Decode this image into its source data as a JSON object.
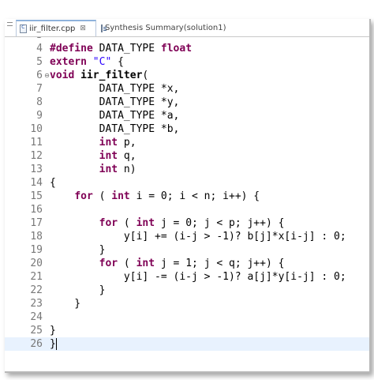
{
  "tabs": [
    {
      "label": "iir_filter.cpp",
      "active": true,
      "close": "⊠"
    },
    {
      "label": "Synthesis Summary(solution1)",
      "active": false
    }
  ],
  "colors": {
    "keyword": "#7f0055",
    "string": "#2a00ff",
    "text": "#000000",
    "line_number": "#787878",
    "current_line": "#e8f2fe",
    "tab_border": "#8fb2db"
  },
  "editor": {
    "top_partial_line": "3",
    "current_line_number": "26",
    "lines": [
      {
        "num": "4",
        "fold": "",
        "code": "#define DATA_TYPE float",
        "tokens": [
          {
            "t": "#define",
            "k": "kw"
          },
          {
            "t": " DATA_TYPE ",
            "k": ""
          },
          {
            "t": "float",
            "k": "kw"
          }
        ]
      },
      {
        "num": "5",
        "fold": "",
        "code": "extern \"C\" {",
        "tokens": [
          {
            "t": "extern",
            "k": "kw"
          },
          {
            "t": " ",
            "k": ""
          },
          {
            "t": "\"C\"",
            "k": "str"
          },
          {
            "t": " {",
            "k": ""
          }
        ]
      },
      {
        "num": "6",
        "fold": "⊖",
        "code": "void iir_filter(",
        "tokens": [
          {
            "t": "void",
            "k": "kw"
          },
          {
            "t": " ",
            "k": ""
          },
          {
            "t": "iir_filter",
            "k": "bold"
          },
          {
            "t": "(",
            "k": ""
          }
        ]
      },
      {
        "num": "7",
        "fold": "",
        "code": "        DATA_TYPE *x,",
        "tokens": [
          {
            "t": "        DATA_TYPE *x,",
            "k": ""
          }
        ]
      },
      {
        "num": "8",
        "fold": "",
        "code": "        DATA_TYPE *y,",
        "tokens": [
          {
            "t": "        DATA_TYPE *y,",
            "k": ""
          }
        ]
      },
      {
        "num": "9",
        "fold": "",
        "code": "        DATA_TYPE *a,",
        "tokens": [
          {
            "t": "        DATA_TYPE *a,",
            "k": ""
          }
        ]
      },
      {
        "num": "10",
        "fold": "",
        "code": "        DATA_TYPE *b,",
        "tokens": [
          {
            "t": "        DATA_TYPE *b,",
            "k": ""
          }
        ]
      },
      {
        "num": "11",
        "fold": "",
        "code": "        int p,",
        "tokens": [
          {
            "t": "        ",
            "k": ""
          },
          {
            "t": "int",
            "k": "kw"
          },
          {
            "t": " p,",
            "k": ""
          }
        ]
      },
      {
        "num": "12",
        "fold": "",
        "code": "        int q,",
        "tokens": [
          {
            "t": "        ",
            "k": ""
          },
          {
            "t": "int",
            "k": "kw"
          },
          {
            "t": " q,",
            "k": ""
          }
        ]
      },
      {
        "num": "13",
        "fold": "",
        "code": "        int n)",
        "tokens": [
          {
            "t": "        ",
            "k": ""
          },
          {
            "t": "int",
            "k": "kw"
          },
          {
            "t": " n)",
            "k": ""
          }
        ]
      },
      {
        "num": "14",
        "fold": "",
        "code": "{",
        "tokens": [
          {
            "t": "{",
            "k": ""
          }
        ]
      },
      {
        "num": "15",
        "fold": "",
        "code": "    for ( int i = 0; i < n; i++) {",
        "tokens": [
          {
            "t": "    ",
            "k": ""
          },
          {
            "t": "for",
            "k": "kw"
          },
          {
            "t": " ( ",
            "k": ""
          },
          {
            "t": "int",
            "k": "kw"
          },
          {
            "t": " i = 0; i < n; i++) {",
            "k": ""
          }
        ]
      },
      {
        "num": "16",
        "fold": "",
        "code": "",
        "tokens": []
      },
      {
        "num": "17",
        "fold": "",
        "code": "        for ( int j = 0; j < p; j++) {",
        "tokens": [
          {
            "t": "        ",
            "k": ""
          },
          {
            "t": "for",
            "k": "kw"
          },
          {
            "t": " ( ",
            "k": ""
          },
          {
            "t": "int",
            "k": "kw"
          },
          {
            "t": " j = 0; j < p; j++) {",
            "k": ""
          }
        ]
      },
      {
        "num": "18",
        "fold": "",
        "code": "            y[i] += (i-j > -1)? b[j]*x[i-j] : 0;",
        "tokens": [
          {
            "t": "            y[i] += (i-j > -1)? b[j]*x[i-j] : 0;",
            "k": ""
          }
        ]
      },
      {
        "num": "19",
        "fold": "",
        "code": "        }",
        "tokens": [
          {
            "t": "        }",
            "k": ""
          }
        ]
      },
      {
        "num": "20",
        "fold": "",
        "code": "        for ( int j = 1; j < q; j++) {",
        "tokens": [
          {
            "t": "        ",
            "k": ""
          },
          {
            "t": "for",
            "k": "kw"
          },
          {
            "t": " ( ",
            "k": ""
          },
          {
            "t": "int",
            "k": "kw"
          },
          {
            "t": " j = 1; j < q; j++) {",
            "k": ""
          }
        ]
      },
      {
        "num": "21",
        "fold": "",
        "code": "            y[i] -= (i-j > -1)? a[j]*y[i-j] : 0;",
        "tokens": [
          {
            "t": "            y[i] -= (i-j > -1)? a[j]*y[i-j] : 0;",
            "k": ""
          }
        ]
      },
      {
        "num": "22",
        "fold": "",
        "code": "        }",
        "tokens": [
          {
            "t": "        }",
            "k": ""
          }
        ]
      },
      {
        "num": "23",
        "fold": "",
        "code": "    }",
        "tokens": [
          {
            "t": "    }",
            "k": ""
          }
        ]
      },
      {
        "num": "24",
        "fold": "",
        "code": "",
        "tokens": []
      },
      {
        "num": "25",
        "fold": "",
        "code": "}",
        "tokens": [
          {
            "t": "}",
            "k": ""
          }
        ]
      },
      {
        "num": "26",
        "fold": "",
        "code": "}",
        "tokens": [
          {
            "t": "}",
            "k": ""
          }
        ]
      }
    ]
  }
}
